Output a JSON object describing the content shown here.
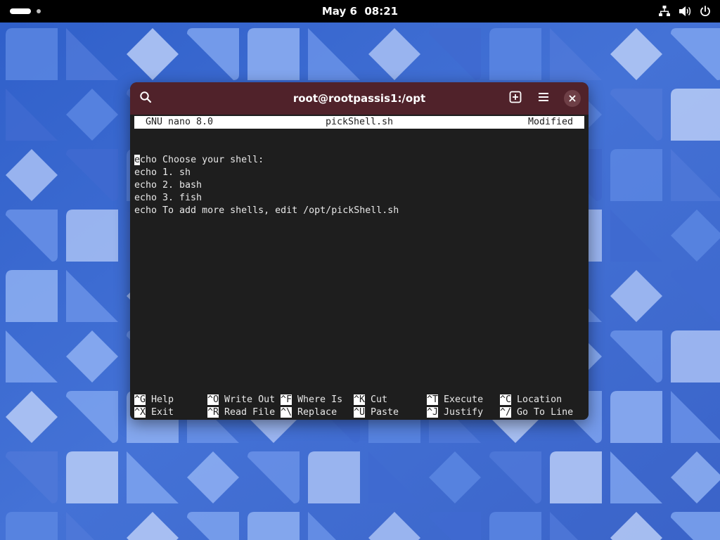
{
  "topbar": {
    "date": "May 6",
    "time": "08:21",
    "icons": [
      "network-icon",
      "volume-icon",
      "power-icon"
    ]
  },
  "window": {
    "title": "root@rootpassis1:/opt",
    "header_color": "#50222a",
    "buttons": [
      "search-icon",
      "new-tab-icon",
      "menu-icon",
      "close-icon"
    ]
  },
  "nano": {
    "version": "GNU nano 8.0",
    "filename": "pickShell.sh",
    "status": "Modified",
    "lines": [
      "",
      "echo Choose your shell:",
      "echo 1. sh",
      "echo 2. bash",
      "echo 3. fish",
      "echo To add more shells, edit /opt/pickShell.sh"
    ],
    "cursor": {
      "line": 2,
      "column": 1,
      "char": "e",
      "rest": "cho Choose your shell:"
    },
    "shortcuts_row1": [
      {
        "key": "^G",
        "label": "Help"
      },
      {
        "key": "^O",
        "label": "Write Out"
      },
      {
        "key": "^F",
        "label": "Where Is"
      },
      {
        "key": "^K",
        "label": "Cut"
      },
      {
        "key": "^T",
        "label": "Execute"
      },
      {
        "key": "^C",
        "label": "Location"
      }
    ],
    "shortcuts_row2": [
      {
        "key": "^X",
        "label": "Exit"
      },
      {
        "key": "^R",
        "label": "Read File"
      },
      {
        "key": "^\\",
        "label": "Replace"
      },
      {
        "key": "^U",
        "label": "Paste"
      },
      {
        "key": "^J",
        "label": "Justify"
      },
      {
        "key": "^/",
        "label": "Go To Line"
      }
    ]
  },
  "colors": {
    "wallpaper_base": "#3a63c8",
    "terminal_bg": "#1e1e1e",
    "topbar_bg": "#000000"
  }
}
